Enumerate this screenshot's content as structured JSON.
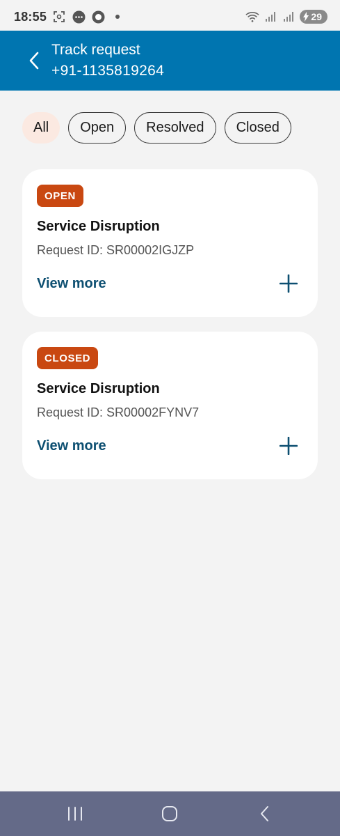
{
  "status_bar": {
    "time": "18:55",
    "battery": "29",
    "icons": [
      "screenshot-icon",
      "chat-icon",
      "record-icon",
      "dot-icon",
      "wifi-icon",
      "signal-icon",
      "signal-icon",
      "battery-charging-icon"
    ]
  },
  "header": {
    "title": "Track request",
    "phone": "+91-1135819264",
    "background_color": "#0075b0"
  },
  "filters": [
    {
      "label": "All",
      "active": true
    },
    {
      "label": "Open",
      "active": false
    },
    {
      "label": "Resolved",
      "active": false
    },
    {
      "label": "Closed",
      "active": false
    }
  ],
  "requests": [
    {
      "status": "OPEN",
      "title": "Service Disruption",
      "request_id": "Request ID: SR00002IGJZP",
      "action": "View more"
    },
    {
      "status": "CLOSED",
      "title": "Service Disruption",
      "request_id": "Request ID: SR00002FYNV7",
      "action": "View more"
    }
  ],
  "colors": {
    "badge": "#c94811",
    "link": "#0d4f71",
    "active_chip": "#fbe9e1",
    "nav_bar": "#646a88"
  },
  "nav": [
    "recent-apps-icon",
    "home-icon",
    "back-icon"
  ]
}
